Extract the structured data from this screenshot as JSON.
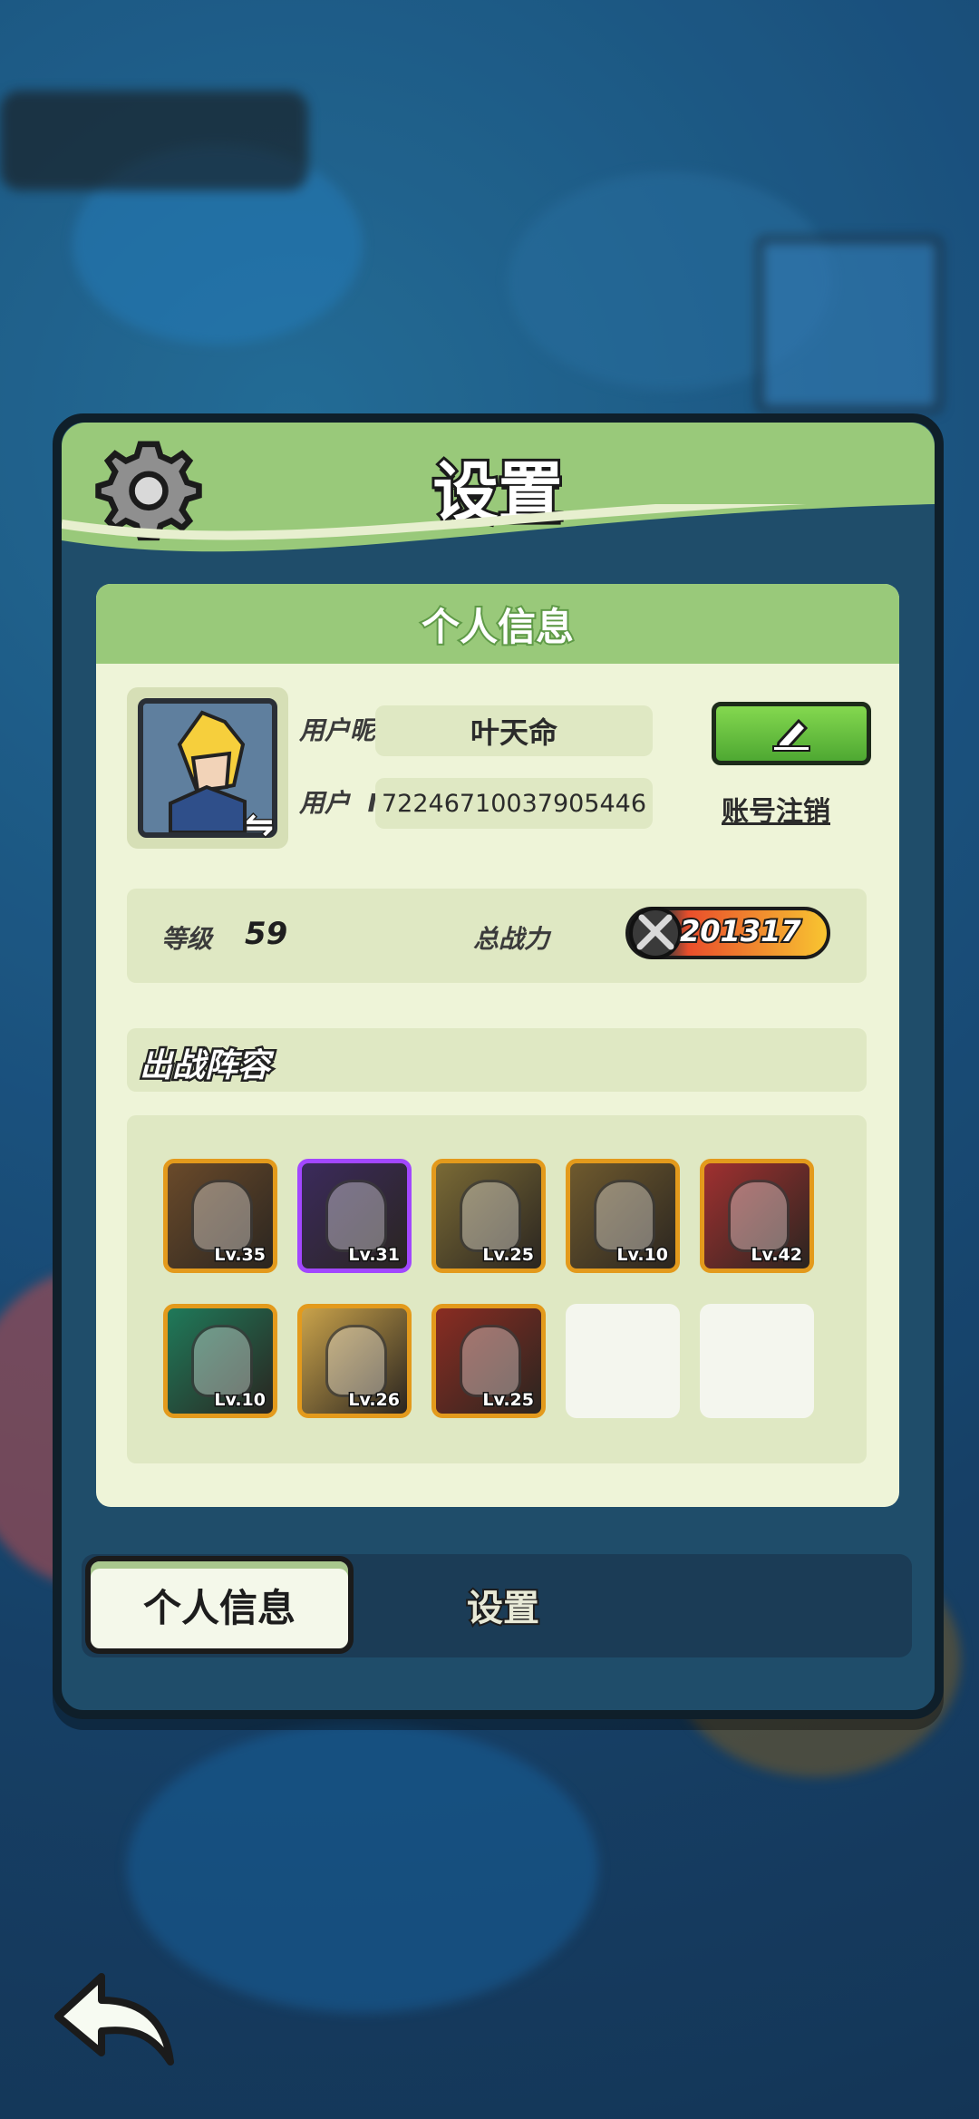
{
  "dialog": {
    "title": "设置"
  },
  "profile_card": {
    "header": "个人信息",
    "nickname_label": "用户昵称",
    "nickname": "叶天命",
    "id_label": "用户  ID",
    "user_id": "7224671003790544​6",
    "cancel_account_link": "账号注销",
    "level_label": "等级",
    "level": "59",
    "power_label": "总战力",
    "power": "201317",
    "lineup_header": "出战阵容"
  },
  "heroes": [
    {
      "level": "Lv.35",
      "frame": "orange",
      "accent": "#6a4a2a"
    },
    {
      "level": "Lv.31",
      "frame": "purple",
      "accent": "#3b2a5c"
    },
    {
      "level": "Lv.25",
      "frame": "orange",
      "accent": "#7a6a35"
    },
    {
      "level": "Lv.10",
      "frame": "orange",
      "accent": "#6f5a2e"
    },
    {
      "level": "Lv.42",
      "frame": "orange",
      "accent": "#a03030"
    },
    {
      "level": "Lv.10",
      "frame": "orange",
      "accent": "#1f7a5a"
    },
    {
      "level": "Lv.26",
      "frame": "orange",
      "accent": "#c9a24a"
    },
    {
      "level": "Lv.25",
      "frame": "orange",
      "accent": "#8a2c22"
    },
    {
      "level": "",
      "frame": "empty",
      "accent": "#f4f6ee"
    },
    {
      "level": "",
      "frame": "empty",
      "accent": "#f4f6ee"
    }
  ],
  "tabs": {
    "active": "个人信息",
    "inactive": "设置"
  },
  "colors": {
    "panel_header": "#99c97a",
    "card_bg": "#eef4d8",
    "edit_button": "#5bb83a",
    "hero_frame_orange": "#e39a1c",
    "hero_frame_purple": "#a247ff"
  }
}
